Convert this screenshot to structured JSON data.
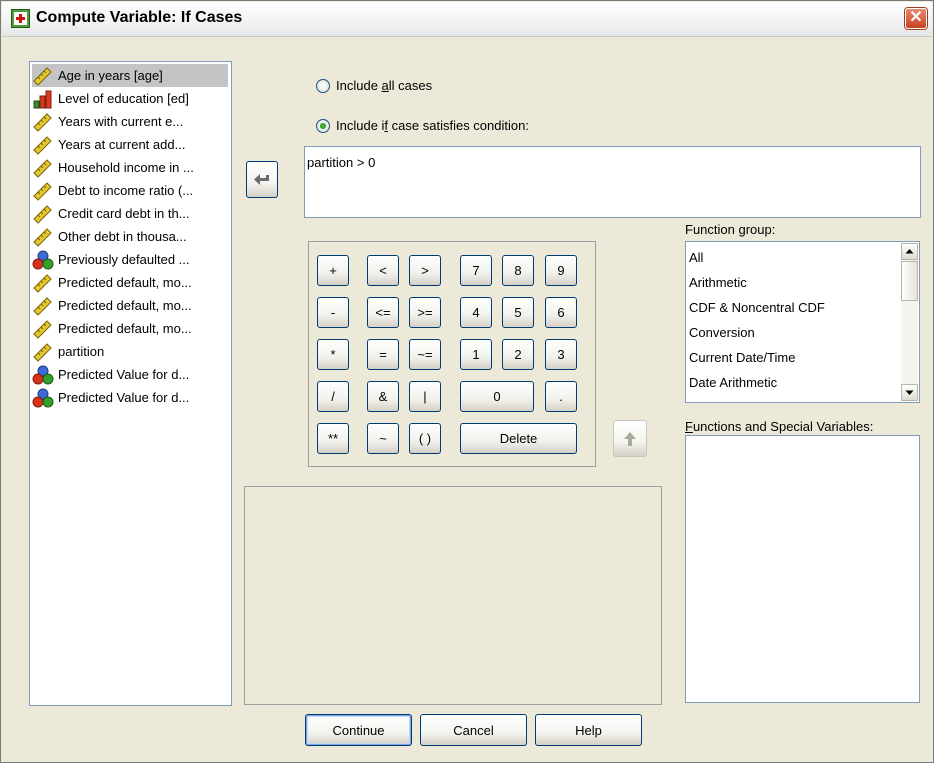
{
  "window": {
    "title": "Compute Variable: If Cases",
    "close_glyph": "✕"
  },
  "variables": [
    {
      "label": "Age in years [age]",
      "icon": "scale-ruler-icon",
      "selected": true
    },
    {
      "label": "Level of education [ed]",
      "icon": "ordinal-bar-icon"
    },
    {
      "label": "Years with current e...",
      "icon": "scale-ruler-icon"
    },
    {
      "label": "Years at current add...",
      "icon": "scale-ruler-icon"
    },
    {
      "label": "Household income in ...",
      "icon": "scale-ruler-icon"
    },
    {
      "label": "Debt to income ratio (...",
      "icon": "scale-ruler-icon"
    },
    {
      "label": "Credit card debt in th...",
      "icon": "scale-ruler-icon"
    },
    {
      "label": "Other debt in thousa...",
      "icon": "scale-ruler-icon"
    },
    {
      "label": "Previously defaulted ...",
      "icon": "nominal-circles-icon"
    },
    {
      "label": "Predicted default, mo...",
      "icon": "scale-ruler-icon"
    },
    {
      "label": "Predicted default, mo...",
      "icon": "scale-ruler-icon"
    },
    {
      "label": "Predicted default, mo...",
      "icon": "scale-ruler-icon"
    },
    {
      "label": "partition",
      "icon": "scale-ruler-icon"
    },
    {
      "label": "Predicted Value for d...",
      "icon": "nominal-circles-icon"
    },
    {
      "label": "Predicted Value for d...",
      "icon": "nominal-circles-icon"
    }
  ],
  "options": {
    "include_all": {
      "pre": "Include ",
      "acc": "a",
      "post": "ll cases",
      "checked": false
    },
    "include_if": {
      "pre": "Include i",
      "acc": "f",
      "post": " case satisfies condition:",
      "checked": true
    }
  },
  "condition_text": "partition > 0",
  "keypad": {
    "row1": [
      "+",
      "<",
      ">",
      "7",
      "8",
      "9"
    ],
    "row2": [
      "-",
      "<=",
      ">=",
      "4",
      "5",
      "6"
    ],
    "row3": [
      "*",
      "=",
      "~=",
      "1",
      "2",
      "3"
    ],
    "row4": [
      "/",
      "&",
      "|",
      "0",
      "."
    ],
    "row5": [
      "**",
      "~",
      "( )",
      "Delete"
    ]
  },
  "function_group": {
    "label_pre": "Function ",
    "label_acc": "g",
    "label_post": "roup:",
    "items": [
      "All",
      "Arithmetic",
      "CDF & Noncentral CDF",
      "Conversion",
      "Current Date/Time",
      "Date Arithmetic"
    ]
  },
  "special_vars": {
    "label_acc": "F",
    "label_post": "unctions and Special Variables:"
  },
  "buttons": {
    "continue": "Continue",
    "cancel": "Cancel",
    "help": "Help"
  },
  "colors": {
    "selection": "#c4c4c4",
    "dialog_bg": "#ece9d8",
    "close_red": "#c8421f"
  }
}
